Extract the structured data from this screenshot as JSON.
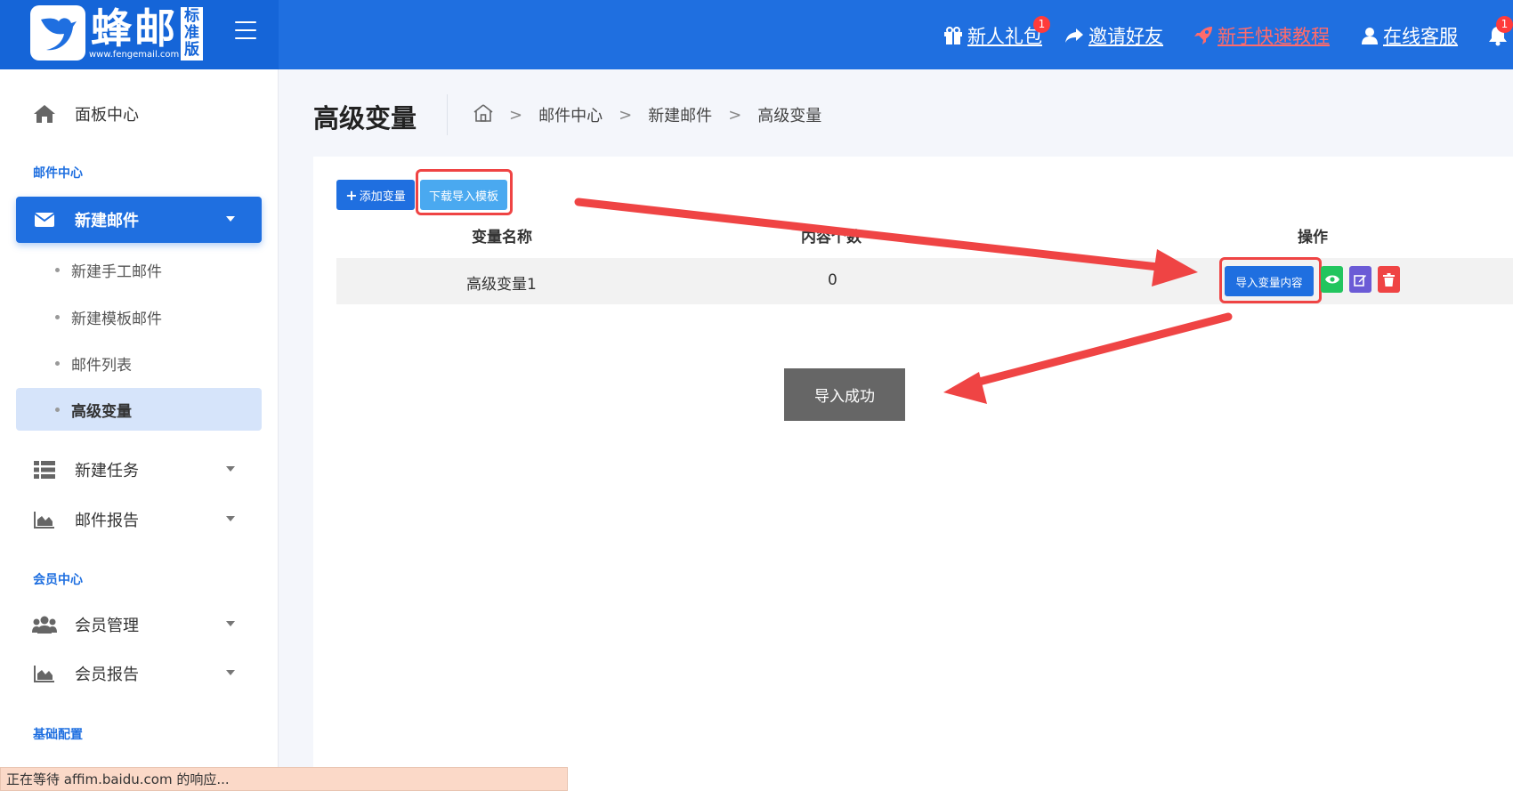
{
  "app": {
    "name": "蜂邮",
    "url": "www.fengemail.com",
    "edition": "标准版"
  },
  "topnav": {
    "gift": {
      "label": "新人礼包",
      "badge": "1"
    },
    "invite": {
      "label": "邀请好友"
    },
    "tutorial": {
      "label": "新手快速教程"
    },
    "support": {
      "label": "在线客服"
    },
    "notifications": {
      "badge": "1"
    }
  },
  "sidebar": {
    "dashboard": "面板中心",
    "sections": {
      "mail_center": "邮件中心",
      "member_center": "会员中心",
      "basic_config": "基础配置"
    },
    "new_mail": "新建邮件",
    "sub_items": [
      "新建手工邮件",
      "新建模板邮件",
      "邮件列表",
      "高级变量"
    ],
    "new_task": "新建任务",
    "mail_report": "邮件报告",
    "member_manage": "会员管理",
    "member_report": "会员报告"
  },
  "page": {
    "title": "高级变量",
    "breadcrumb": [
      "邮件中心",
      "新建邮件",
      "高级变量"
    ]
  },
  "toolbar": {
    "add_label": "添加变量",
    "download_label": "下载导入模板"
  },
  "table": {
    "headers": [
      "变量名称",
      "内容个数",
      "操作"
    ],
    "rows": [
      {
        "name": "高级变量1",
        "count": "0",
        "import_label": "导入变量内容"
      }
    ]
  },
  "toast": {
    "message": "导入成功"
  },
  "statusbar": {
    "text": "正在等待 affim.baidu.com 的响应..."
  },
  "colors": {
    "primary": "#1f6fe0",
    "download": "#4aa9f0",
    "view": "#22c55e",
    "edit": "#6b5bd6",
    "delete": "#ef4444",
    "annotation": "#ef4444"
  }
}
